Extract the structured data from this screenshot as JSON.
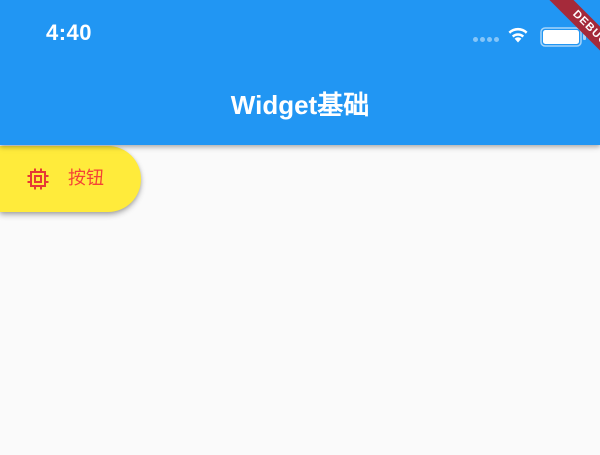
{
  "status_bar": {
    "time": "4:40",
    "icons": [
      "signal-dots-icon",
      "wifi-icon",
      "battery-icon"
    ]
  },
  "app_bar": {
    "title": "Widget基础",
    "background_color": "#2196f3"
  },
  "debug_banner": {
    "label": "DEBUG"
  },
  "button": {
    "label": "按钮",
    "icon": "memory-chip-icon",
    "background_color": "#ffeb3b",
    "text_color": "#f44336"
  },
  "page": {
    "background_color": "#fafafa"
  }
}
